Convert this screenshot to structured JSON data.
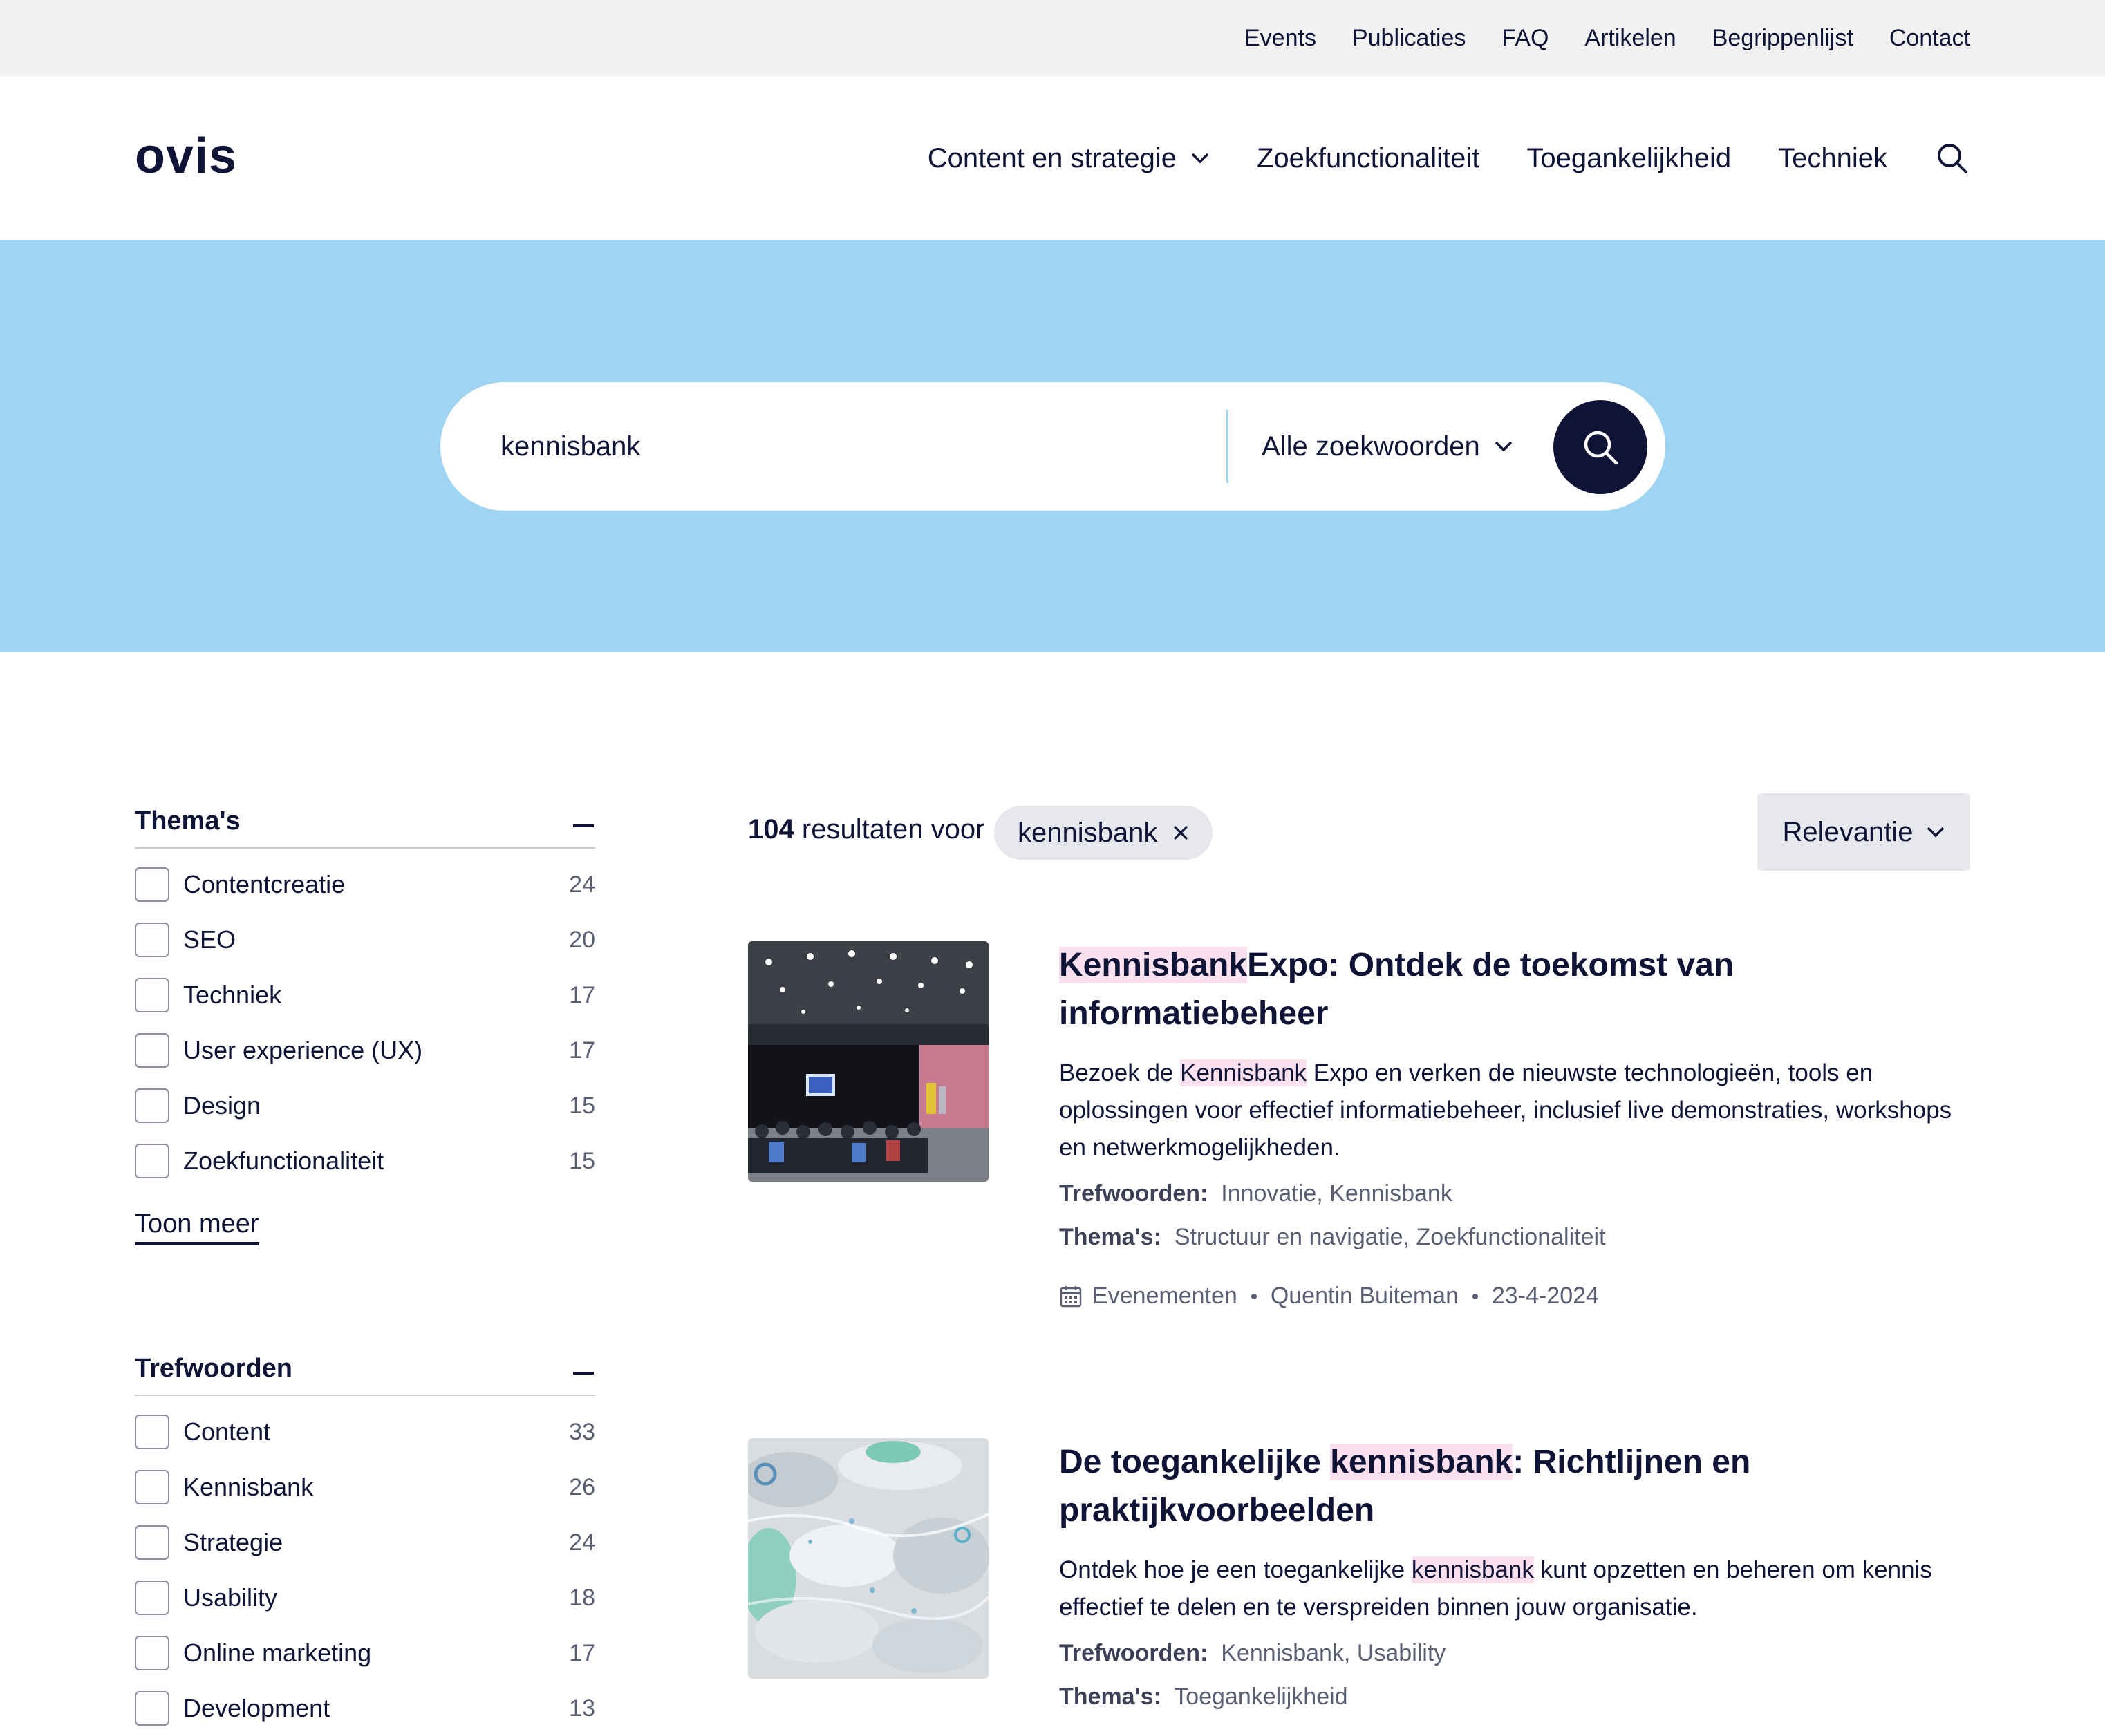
{
  "utility_nav": [
    "Events",
    "Publicaties",
    "FAQ",
    "Artikelen",
    "Begrippenlijst",
    "Contact"
  ],
  "logo": "ovis",
  "main_nav": {
    "content": "Content en strategie",
    "zoek": "Zoekfunctionaliteit",
    "toeg": "Toegankelijkheid",
    "techniek": "Techniek"
  },
  "search": {
    "value": "kennisbank",
    "mode": "Alle zoekwoorden"
  },
  "filters": {
    "themas": {
      "title": "Thema's",
      "items": [
        {
          "label": "Contentcreatie",
          "count": "24"
        },
        {
          "label": "SEO",
          "count": "20"
        },
        {
          "label": "Techniek",
          "count": "17"
        },
        {
          "label": "User experience (UX)",
          "count": "17"
        },
        {
          "label": "Design",
          "count": "15"
        },
        {
          "label": "Zoekfunctionaliteit",
          "count": "15"
        }
      ],
      "show_more": "Toon meer"
    },
    "trefwoorden": {
      "title": "Trefwoorden",
      "items": [
        {
          "label": "Content",
          "count": "33"
        },
        {
          "label": "Kennisbank",
          "count": "26"
        },
        {
          "label": "Strategie",
          "count": "24"
        },
        {
          "label": "Usability",
          "count": "18"
        },
        {
          "label": "Online marketing",
          "count": "17"
        },
        {
          "label": "Development",
          "count": "13"
        }
      ]
    }
  },
  "results": {
    "count": "104",
    "count_text": "resultaten voor",
    "query": "kennisbank",
    "sort": "Relevantie",
    "items": [
      {
        "title_hl": "Kennisbank",
        "title_rest": "Expo: Ontdek de toekomst van informatiebeheer",
        "desc_pre": "Bezoek de ",
        "desc_hl": "Kennisbank",
        "desc_post": " Expo en verken de nieuwste technologieën, tools en oplossingen voor effectief informatiebeheer, inclusief live demonstraties, workshops en netwerkmogelijkheden.",
        "tags_label": "Trefwoorden:",
        "tags": "Innovatie, Kennisbank",
        "themes_label": "Thema's:",
        "themes": "Structuur en navigatie, Zoekfunctionaliteit",
        "type": "Evenementen",
        "author": "Quentin Buiteman",
        "date": "23-4-2024"
      },
      {
        "title_pre": "De toegankelijke ",
        "title_hl": "kennisbank",
        "title_post": ": Richtlijnen en praktijkvoorbeelden",
        "desc_pre": "Ontdek hoe je een toegankelijke ",
        "desc_hl": "kennisbank",
        "desc_post": " kunt opzetten en beheren om kennis effectief te delen en te verspreiden binnen jouw organisatie.",
        "tags_label": "Trefwoorden:",
        "tags": "Kennisbank, Usability",
        "themes_label": "Thema's:",
        "themes": "Toegankelijkheid"
      }
    ]
  },
  "colors": {
    "navy": "#0f1437",
    "hero": "#9fd4f2",
    "highlight": "#fbe1f0"
  }
}
